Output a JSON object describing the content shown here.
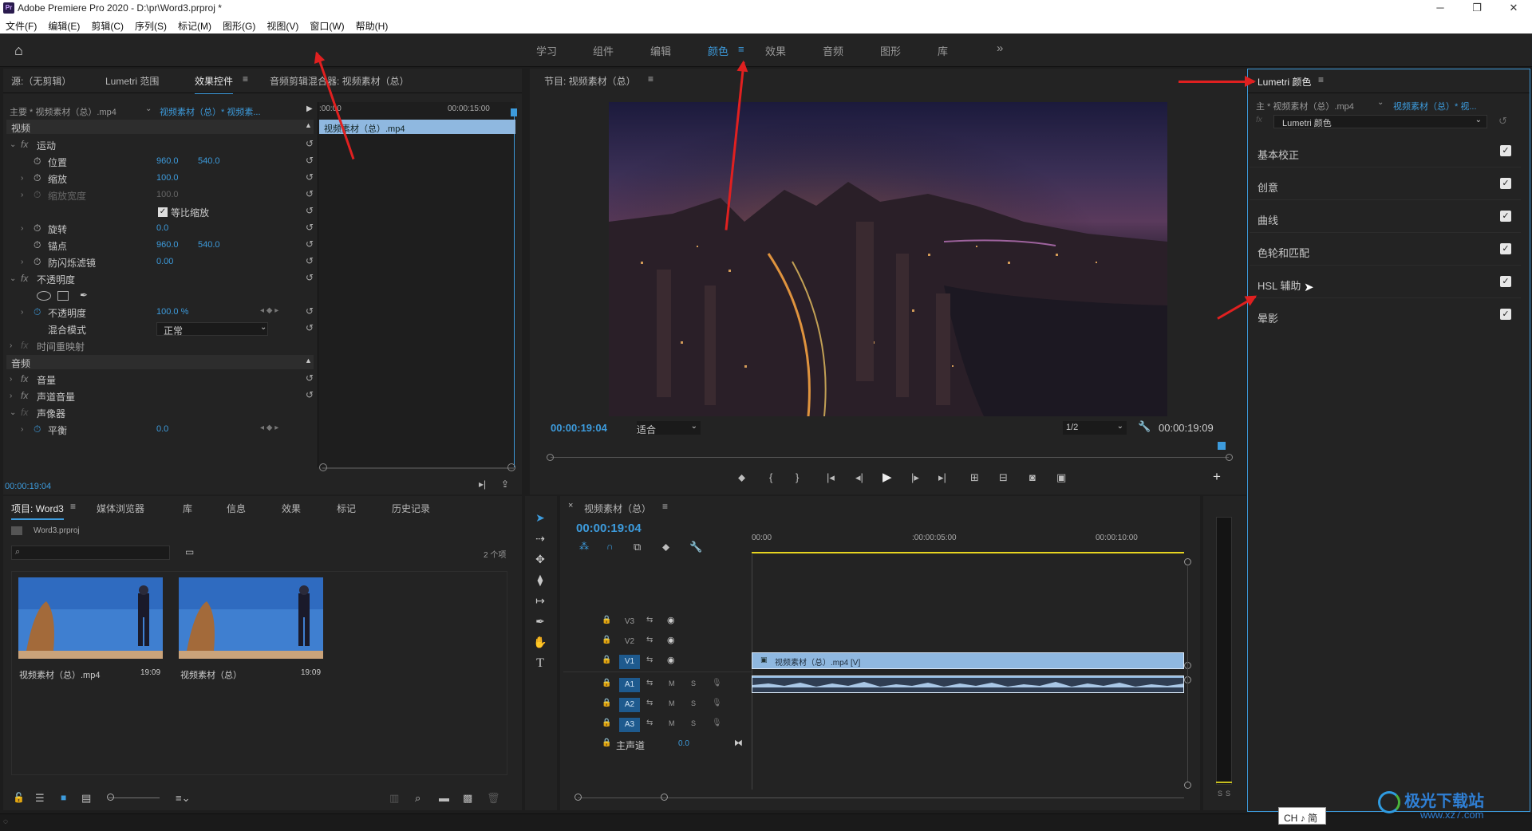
{
  "window": {
    "title": "Adobe Premiere Pro 2020 - D:\\pr\\Word3.prproj *",
    "logo": "Pr"
  },
  "menu": [
    "文件(F)",
    "编辑(E)",
    "剪辑(C)",
    "序列(S)",
    "标记(M)",
    "图形(G)",
    "视图(V)",
    "窗口(W)",
    "帮助(H)"
  ],
  "workspaces": [
    "学习",
    "组件",
    "编辑",
    "颜色",
    "效果",
    "音频",
    "图形",
    "库"
  ],
  "workspace_active": "颜色",
  "more": "»",
  "source_panel": {
    "tabs": [
      "源:（无剪辑）",
      "Lumetri 范围",
      "效果控件",
      "音频剪辑混合器: 视频素材（总）"
    ],
    "active": "效果控件",
    "clip_main": "主要 * 视频素材（总）.mp4",
    "clip_seq": "视频素材（总）* 视频素...",
    "time_start": ":00:00",
    "time_end": "00:00:15:00",
    "clip_bar": "视频素材（总）.mp4",
    "timecode": "00:00:19:04"
  },
  "effect_controls": {
    "video_hdr": "视频",
    "audio_hdr": "音频",
    "motion": "运动",
    "position": "位置",
    "pos_x": "960.0",
    "pos_y": "540.0",
    "scale": "缩放",
    "scale_v": "100.0",
    "scale_w": "缩放宽度",
    "scale_w_v": "100.0",
    "uniform": "等比缩放",
    "rotation": "旋转",
    "rot_v": "0.0",
    "anchor": "锚点",
    "anc_x": "960.0",
    "anc_y": "540.0",
    "flicker": "防闪烁滤镜",
    "flicker_v": "0.00",
    "opacity_grp": "不透明度",
    "opacity": "不透明度",
    "opacity_v": "100.0 %",
    "blend": "混合模式",
    "blend_v": "正常",
    "time_remap": "时间重映射",
    "volume": "音量",
    "ch_volume": "声道音量",
    "panner": "声像器",
    "balance": "平衡",
    "balance_v": "0.0"
  },
  "program": {
    "title": "节目: 视频素材（总）",
    "timecode": "00:00:19:04",
    "fit": "适合",
    "quality": "1/2",
    "duration": "00:00:19:09"
  },
  "project": {
    "tabs": [
      "项目: Word3",
      "媒体浏览器",
      "库",
      "信息",
      "效果",
      "标记",
      "历史记录"
    ],
    "file": "Word3.prproj",
    "count": "2 个项",
    "items": [
      {
        "name": "视频素材（总）.mp4",
        "dur": "19:09"
      },
      {
        "name": "视频素材（总）",
        "dur": "19:09"
      }
    ]
  },
  "timeline": {
    "title": "视频素材（总）",
    "timecode": "00:00:19:04",
    "ruler": [
      "00:00",
      ":00:00:05:00",
      "00:00:10:00"
    ],
    "tracks": [
      "V3",
      "V2",
      "V1",
      "A1",
      "A2",
      "A3"
    ],
    "master": "主声道",
    "master_v": "0.0",
    "clip_video": "视频素材（总）.mp4 [V]",
    "m": "M",
    "s": "S"
  },
  "meter": {
    "labels": [
      "S",
      "S"
    ]
  },
  "lumetri": {
    "title": "Lumetri 颜色",
    "clip_main": "主 * 视频素材（总）.mp4",
    "clip_seq": "视频素材（总）* 视...",
    "effect": "Lumetri 颜色",
    "sections": [
      "基本校正",
      "创意",
      "曲线",
      "色轮和匹配",
      "HSL 辅助",
      "晕影"
    ]
  },
  "ime": "CH ♪ 简",
  "watermark": {
    "brand": "极光下载站",
    "url": "www.xz7.com"
  },
  "colors": {
    "accent": "#3d9bdc",
    "arrow": "#e02020"
  }
}
